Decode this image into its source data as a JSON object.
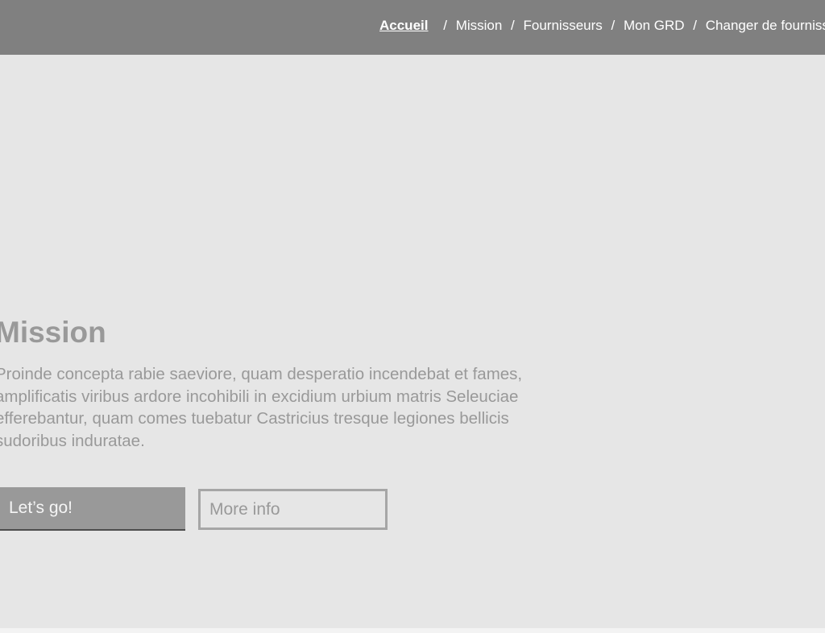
{
  "header": {
    "nav_items": [
      "Accueil",
      "Mission",
      "Fournisseurs",
      "Mon GRD",
      "Changer de fournisseur"
    ],
    "separator": "/"
  },
  "hero": {
    "title": "Mission",
    "lead": "Proinde concepta rabie saeviore, quam desperatio incendebat et fames, amplificatis viribus ardore incohibili in excidium urbium matris Seleuciae efferebantur, quam comes tuebatur Castricius tresque legiones bellicis sudoribus induratae.",
    "primary_button_label": "Let’s go!",
    "secondary_button_label": "More info"
  }
}
